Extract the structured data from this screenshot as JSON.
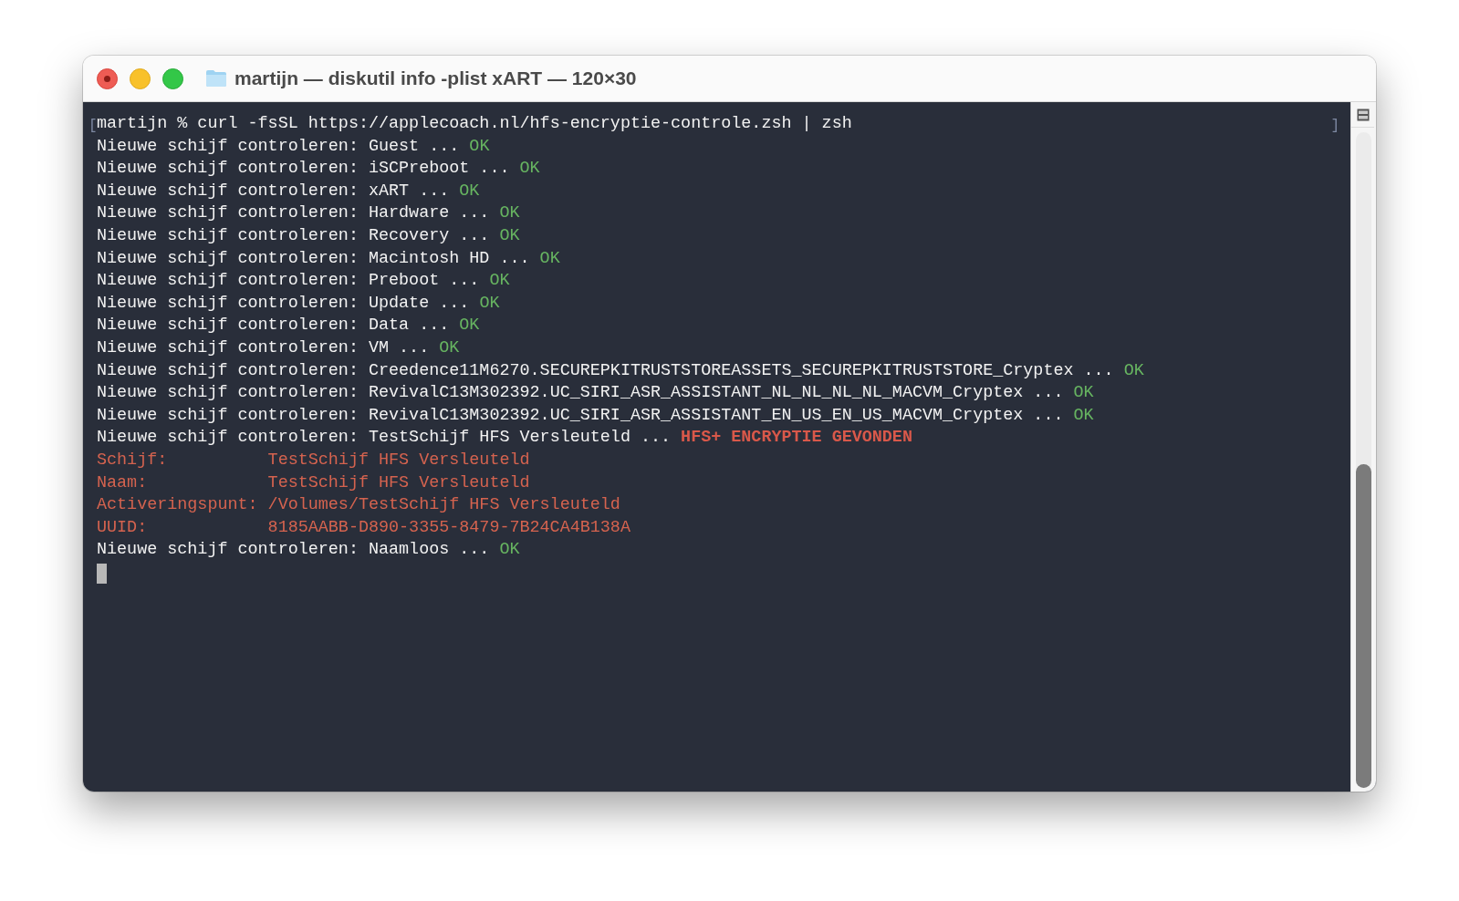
{
  "window": {
    "title": "martijn — diskutil info -plist xART — 120×30"
  },
  "prompt_marks": [
    "[",
    "]"
  ],
  "lines": [
    {
      "segments": [
        {
          "kind": "text",
          "text": "martijn % curl -fsSL https://applecoach.nl/hfs-encryptie-controle.zsh | zsh"
        }
      ]
    },
    {
      "segments": [
        {
          "kind": "text",
          "text": "Nieuwe schijf controleren: Guest ..."
        },
        {
          "kind": "ok",
          "text": "OK"
        }
      ]
    },
    {
      "segments": [
        {
          "kind": "text",
          "text": "Nieuwe schijf controleren: iSCPreboot ..."
        },
        {
          "kind": "ok",
          "text": "OK"
        }
      ]
    },
    {
      "segments": [
        {
          "kind": "text",
          "text": "Nieuwe schijf controleren: xART ..."
        },
        {
          "kind": "ok",
          "text": "OK"
        }
      ]
    },
    {
      "segments": [
        {
          "kind": "text",
          "text": "Nieuwe schijf controleren: Hardware ..."
        },
        {
          "kind": "ok",
          "text": "OK"
        }
      ]
    },
    {
      "segments": [
        {
          "kind": "text",
          "text": "Nieuwe schijf controleren: Recovery ..."
        },
        {
          "kind": "ok",
          "text": "OK"
        }
      ]
    },
    {
      "segments": [
        {
          "kind": "text",
          "text": "Nieuwe schijf controleren: Macintosh HD ..."
        },
        {
          "kind": "ok",
          "text": "OK"
        }
      ]
    },
    {
      "segments": [
        {
          "kind": "text",
          "text": "Nieuwe schijf controleren: Preboot ..."
        },
        {
          "kind": "ok",
          "text": "OK"
        }
      ]
    },
    {
      "segments": [
        {
          "kind": "text",
          "text": "Nieuwe schijf controleren: Update ..."
        },
        {
          "kind": "ok",
          "text": "OK"
        }
      ]
    },
    {
      "segments": [
        {
          "kind": "text",
          "text": "Nieuwe schijf controleren: Data ..."
        },
        {
          "kind": "ok",
          "text": "OK"
        }
      ]
    },
    {
      "segments": [
        {
          "kind": "text",
          "text": "Nieuwe schijf controleren: VM ..."
        },
        {
          "kind": "ok",
          "text": "OK"
        }
      ]
    },
    {
      "segments": [
        {
          "kind": "text",
          "text": "Nieuwe schijf controleren: Creedence11M6270.SECUREPKITRUSTSTOREASSETS_SECUREPKITRUSTSTORE_Cryptex ..."
        },
        {
          "kind": "ok",
          "text": "OK"
        }
      ]
    },
    {
      "segments": [
        {
          "kind": "text",
          "text": "Nieuwe schijf controleren: RevivalC13M302392.UC_SIRI_ASR_ASSISTANT_NL_NL_NL_NL_MACVM_Cryptex ..."
        },
        {
          "kind": "ok",
          "text": "OK"
        }
      ]
    },
    {
      "segments": [
        {
          "kind": "text",
          "text": "Nieuwe schijf controleren: RevivalC13M302392.UC_SIRI_ASR_ASSISTANT_EN_US_EN_US_MACVM_Cryptex ..."
        },
        {
          "kind": "ok",
          "text": "OK"
        }
      ]
    },
    {
      "segments": [
        {
          "kind": "text",
          "text": "Nieuwe schijf controleren: TestSchijf HFS Versleuteld ..."
        },
        {
          "kind": "alert",
          "text": "HFS+ ENCRYPTIE GEVONDEN"
        }
      ]
    },
    {
      "segments": [
        {
          "kind": "label",
          "text": "Schijf:"
        },
        {
          "kind": "detail",
          "text": "TestSchijf HFS Versleuteld"
        }
      ]
    },
    {
      "segments": [
        {
          "kind": "label",
          "text": "Naam:"
        },
        {
          "kind": "detail",
          "text": "TestSchijf HFS Versleuteld"
        }
      ]
    },
    {
      "segments": [
        {
          "kind": "label",
          "text": "Activeringspunt:"
        },
        {
          "kind": "detail",
          "text": "/Volumes/TestSchijf HFS Versleuteld"
        }
      ]
    },
    {
      "segments": [
        {
          "kind": "label",
          "text": "UUID:"
        },
        {
          "kind": "detail",
          "text": "8185AABB-D890-3355-8479-7B24CA4B138A"
        }
      ]
    },
    {
      "segments": [
        {
          "kind": "text",
          "text": "Nieuwe schijf controleren: Naamloos ..."
        },
        {
          "kind": "ok",
          "text": "OK"
        }
      ]
    }
  ]
}
